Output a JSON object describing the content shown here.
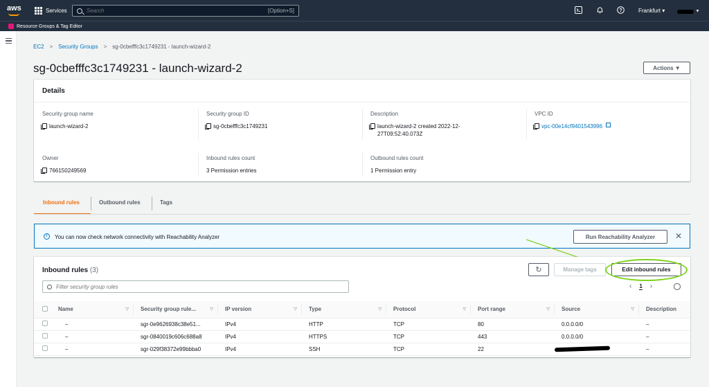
{
  "topnav": {
    "logo": "aws",
    "services": "Services",
    "search_placeholder": "Search",
    "search_shortcut": "[Option+S]",
    "region": "Frankfurt ▾"
  },
  "subnav": {
    "label": "Resource Groups & Tag Editor"
  },
  "breadcrumb": {
    "items": [
      "EC2",
      "Security Groups",
      "sg-0cbefffc3c1749231 - launch-wizard-2"
    ]
  },
  "page": {
    "title": "sg-0cbefffc3c1749231 - launch-wizard-2",
    "actions_label": "Actions ▼"
  },
  "details": {
    "heading": "Details",
    "fields": [
      {
        "label": "Security group name",
        "value": "launch-wizard-2"
      },
      {
        "label": "Security group ID",
        "value": "sg-0cbefffc3c1749231"
      },
      {
        "label": "Description",
        "value": "launch-wizard-2 created 2022-12-27T09:52:40.073Z"
      },
      {
        "label": "VPC ID",
        "value": "vpc-00e14cf9401543996"
      },
      {
        "label": "Owner",
        "value": "766150249569"
      },
      {
        "label": "Inbound rules count",
        "value": "3 Permission entries"
      },
      {
        "label": "Outbound rules count",
        "value": "1 Permission entry"
      }
    ]
  },
  "tabs": [
    "Inbound rules",
    "Outbound rules",
    "Tags"
  ],
  "alert": {
    "message": "You can now check network connectivity with Reachability Analyzer",
    "button": "Run Reachability Analyzer"
  },
  "inbound": {
    "heading": "Inbound rules",
    "count": "(3)",
    "manage_tags": "Manage tags",
    "edit_label": "Edit inbound rules",
    "filter_placeholder": "Filter security group rules",
    "page": "1",
    "columns": [
      "Name",
      "Security group rule...",
      "IP version",
      "Type",
      "Protocol",
      "Port range",
      "Source",
      "Description"
    ],
    "rows": [
      [
        "–",
        "sgr-0e9626938c38e51...",
        "IPv4",
        "HTTP",
        "TCP",
        "80",
        "0.0.0.0/0",
        "–"
      ],
      [
        "–",
        "sgr-0840019c606c688a8",
        "IPv4",
        "HTTPS",
        "TCP",
        "443",
        "0.0.0.0/0",
        "–"
      ],
      [
        "–",
        "sgr-029f38372e99bbba0",
        "IPv4",
        "SSH",
        "TCP",
        "22",
        "",
        "–"
      ]
    ]
  },
  "colors": {
    "nav_bg": "#232f3e",
    "accent_orange": "#ec7211",
    "link_blue": "#0073bb",
    "highlight_green": "#7dd31c"
  }
}
